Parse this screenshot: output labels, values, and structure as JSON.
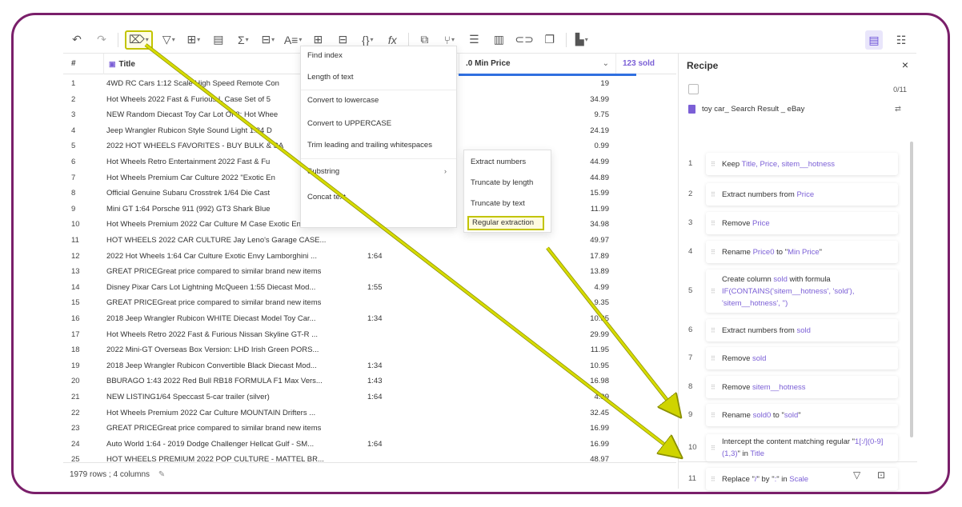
{
  "toolbar": {
    "items": [
      "undo-icon",
      "redo-icon",
      "clean-icon",
      "filter-icon",
      "column-icon",
      "calc-icon",
      "sum-icon",
      "table-icon",
      "text-icon",
      "group-icon",
      "split-icon",
      "braces-icon",
      "fx-icon",
      "merge-icon",
      "tree-icon",
      "list-icon",
      "layout-icon",
      "link-icon",
      "copy-icon",
      "chart-icon"
    ],
    "fx_label": "fx",
    "sum_label": "Σ"
  },
  "table": {
    "headers": {
      "num": "#",
      "title": "Title",
      "min_price": ".0 Min Price",
      "sold": "123 sold"
    },
    "rows": [
      {
        "n": "1",
        "title": "4WD RC Cars 1:12 Scale High Speed Remote Con",
        "scale": "",
        "price": "19"
      },
      {
        "n": "2",
        "title": "Hot Wheels 2022 Fast & Furious L Case Set of 5",
        "scale": "",
        "price": "34.99"
      },
      {
        "n": "3",
        "title": "NEW Random Diecast Toy Car Lot Of 3: Hot Whee",
        "scale": "",
        "price": "9.75"
      },
      {
        "n": "4",
        "title": "Jeep Wrangler Rubicon Style Sound Light 1:24 D",
        "scale": "",
        "price": "24.19"
      },
      {
        "n": "5",
        "title": "2022 HOT WHEELS FAVORITES - BUY BULK & SA",
        "scale": "",
        "price": "0.99"
      },
      {
        "n": "6",
        "title": "Hot Wheels Retro Entertainment 2022 Fast & Fu",
        "scale": "",
        "price": "44.99"
      },
      {
        "n": "7",
        "title": "Hot Wheels Premium Car Culture 2022 \"Exotic En",
        "scale": "",
        "price": "44.89"
      },
      {
        "n": "8",
        "title": "Official Genuine Subaru Crosstrek 1/64 Die Cast",
        "scale": "",
        "price": "15.99"
      },
      {
        "n": "9",
        "title": "Mini GT 1:64 Porsche 911 (992) GT3 Shark Blue",
        "scale": "",
        "price": "11.99"
      },
      {
        "n": "10",
        "title": "Hot Wheels Premium 2022 Car Culture M Case Exotic Envy ...",
        "scale": "",
        "price": "34.98"
      },
      {
        "n": "11",
        "title": "HOT WHEELS 2022 CAR CULTURE Jay Leno's Garage CASE...",
        "scale": "",
        "price": "49.97"
      },
      {
        "n": "12",
        "title": "2022 Hot Wheels 1:64 Car Culture Exotic Envy Lamborghini ...",
        "scale": "1:64",
        "price": "17.89"
      },
      {
        "n": "13",
        "title": "GREAT PRICEGreat price compared to similar brand new items",
        "scale": "",
        "price": "13.89"
      },
      {
        "n": "14",
        "title": "Disney Pixar Cars Lot Lightning McQueen 1:55 Diecast Mod...",
        "scale": "1:55",
        "price": "4.99"
      },
      {
        "n": "15",
        "title": "GREAT PRICEGreat price compared to similar brand new items",
        "scale": "",
        "price": "9.35"
      },
      {
        "n": "16",
        "title": "2018 Jeep Wrangler Rubicon WHITE Diecast Model Toy Car...",
        "scale": "1:34",
        "price": "10.95"
      },
      {
        "n": "17",
        "title": "Hot Wheels Retro 2022 Fast & Furious Nissan Skyline GT-R ...",
        "scale": "",
        "price": "29.99"
      },
      {
        "n": "18",
        "title": "2022 Mini-GT Overseas Box Version: LHD Irish Green PORS...",
        "scale": "",
        "price": "11.95"
      },
      {
        "n": "19",
        "title": "2018 Jeep Wrangler Rubicon Convertible Black Diecast Mod...",
        "scale": "1:34",
        "price": "10.95"
      },
      {
        "n": "20",
        "title": "BBURAGO 1:43 2022 Red Bull RB18 FORMULA F1 Max Vers...",
        "scale": "1:43",
        "price": "16.98"
      },
      {
        "n": "21",
        "title": "NEW LISTING1/64 Speccast 5-car trailer (silver)",
        "scale": "1:64",
        "price": "4.99"
      },
      {
        "n": "22",
        "title": "Hot Wheels Premium 2022 Car Culture MOUNTAIN Drifters ...",
        "scale": "",
        "price": "32.45"
      },
      {
        "n": "23",
        "title": "GREAT PRICEGreat price compared to similar brand new items",
        "scale": "",
        "price": "16.99"
      },
      {
        "n": "24",
        "title": "Auto World 1:64 - 2019 Dodge Challenger Hellcat Gulf - SM...",
        "scale": "1:64",
        "price": "16.99"
      },
      {
        "n": "25",
        "title": "HOT WHEELS PREMIUM 2022 POP CULTURE - MATTEL BR...",
        "scale": "",
        "price": "48.97"
      }
    ],
    "footer": "1979 rows ; 4 columns"
  },
  "menu": {
    "items": [
      "Find index",
      "Length of text",
      "Convert to lowercase",
      "Convert to UPPERCASE",
      "Trim leading and trailing whitespaces",
      "Substring",
      "Concat text"
    ],
    "submenu": [
      "Extract numbers",
      "Truncate by length",
      "Truncate by text",
      "Regular extraction"
    ]
  },
  "recipe": {
    "title": "Recipe",
    "close": "×",
    "count": "0/11",
    "source": "toy car_ Search Result _ eBay",
    "steps": [
      {
        "n": "1",
        "parts": [
          [
            "Keep ",
            0
          ],
          [
            "Title, Price, sitem__hotness",
            1
          ]
        ]
      },
      {
        "n": "2",
        "parts": [
          [
            "Extract numbers from ",
            0
          ],
          [
            "Price",
            1
          ]
        ]
      },
      {
        "n": "3",
        "parts": [
          [
            "Remove ",
            0
          ],
          [
            "Price",
            1
          ]
        ]
      },
      {
        "n": "4",
        "parts": [
          [
            "Rename ",
            0
          ],
          [
            "Price0",
            1
          ],
          [
            " to \"",
            0
          ],
          [
            "Min Price",
            1
          ],
          [
            "\"",
            0
          ]
        ]
      },
      {
        "n": "5",
        "parts": [
          [
            "Create column ",
            0
          ],
          [
            "sold",
            1
          ],
          [
            " with formula ",
            0
          ],
          [
            "IF(CONTAINS('sitem__hotness', 'sold'), 'sitem__hotness', '')",
            1
          ]
        ]
      },
      {
        "n": "6",
        "parts": [
          [
            "Extract numbers from ",
            0
          ],
          [
            "sold",
            1
          ]
        ]
      },
      {
        "n": "7",
        "parts": [
          [
            "Remove ",
            0
          ],
          [
            "sold",
            1
          ]
        ]
      },
      {
        "n": "8",
        "parts": [
          [
            "Remove ",
            0
          ],
          [
            "sitem__hotness",
            1
          ]
        ]
      },
      {
        "n": "9",
        "parts": [
          [
            "Rename ",
            0
          ],
          [
            "sold0",
            1
          ],
          [
            " to \"",
            0
          ],
          [
            "sold",
            1
          ],
          [
            "\"",
            0
          ]
        ]
      },
      {
        "n": "10",
        "parts": [
          [
            "Intercept the content matching regular \"",
            0
          ],
          [
            "1[:/](0-9](1,3)",
            1
          ],
          [
            "\" in ",
            0
          ],
          [
            "Title",
            1
          ]
        ]
      },
      {
        "n": "11",
        "parts": [
          [
            "Replace \"",
            0
          ],
          [
            "/",
            1
          ],
          [
            "\" by \"",
            0
          ],
          [
            ":",
            1
          ],
          [
            "\" in ",
            0
          ],
          [
            "Scale",
            1
          ]
        ]
      }
    ]
  }
}
